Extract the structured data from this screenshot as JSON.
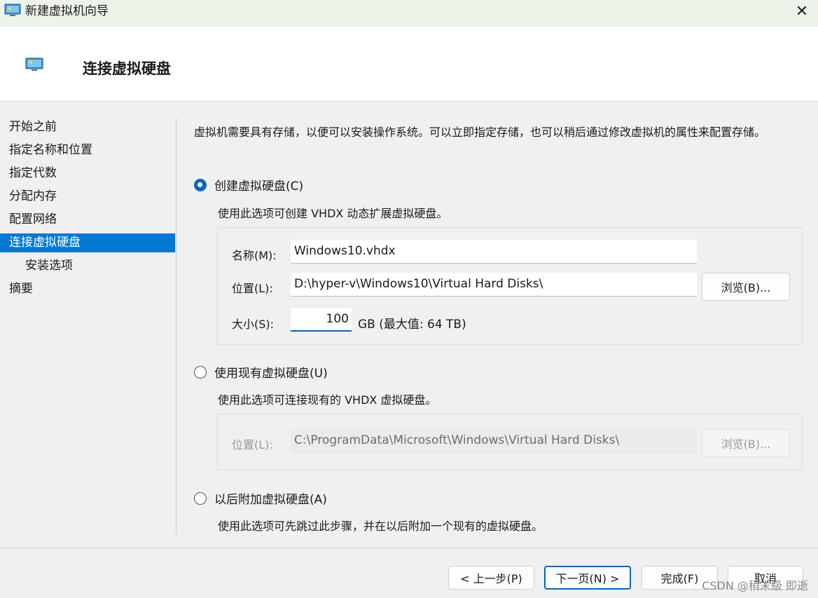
{
  "window": {
    "title": "新建虚拟机向导"
  },
  "header": {
    "title": "连接虚拟硬盘"
  },
  "sidebar": {
    "items": [
      {
        "label": "开始之前"
      },
      {
        "label": "指定名称和位置"
      },
      {
        "label": "指定代数"
      },
      {
        "label": "分配内存"
      },
      {
        "label": "配置网络"
      },
      {
        "label": "连接虚拟硬盘"
      },
      {
        "label": "安装选项"
      },
      {
        "label": "摘要"
      }
    ]
  },
  "main": {
    "description": "虚拟机需要具有存储，以便可以安装操作系统。可以立即指定存储，也可以稍后通过修改虚拟机的属性来配置存储。",
    "option_create": {
      "label": "创建虚拟硬盘(C)",
      "selected": true,
      "description": "使用此选项可创建 VHDX 动态扩展虚拟硬盘。",
      "name_label": "名称(M):",
      "name_value": "Windows10.vhdx",
      "location_label": "位置(L):",
      "location_value": "D:\\hyper-v\\Windows10\\Virtual Hard Disks\\",
      "browse_label": "浏览(B)...",
      "size_label": "大小(S):",
      "size_value": "100",
      "size_unit": "GB (最大值: 64 TB)"
    },
    "option_existing": {
      "label": "使用现有虚拟硬盘(U)",
      "selected": false,
      "description": "使用此选项可连接现有的 VHDX 虚拟硬盘。",
      "location_label": "位置(L):",
      "location_value": "C:\\ProgramData\\Microsoft\\Windows\\Virtual Hard Disks\\",
      "browse_label": "浏览(B)..."
    },
    "option_later": {
      "label": "以后附加虚拟硬盘(A)",
      "selected": false,
      "description": "使用此选项可先跳过此步骤，并在以后附加一个现有的虚拟硬盘。"
    }
  },
  "footer": {
    "prev_label": "< 上一步(P)",
    "next_label": "下一页(N) >",
    "finish_label": "完成(F)",
    "cancel_label": "取消"
  },
  "watermark": "CSDN @稍末級 即逝",
  "colors": {
    "accent": "#0078d4",
    "titlebar": "#eef3ea",
    "panel": "#f0f0f0"
  }
}
